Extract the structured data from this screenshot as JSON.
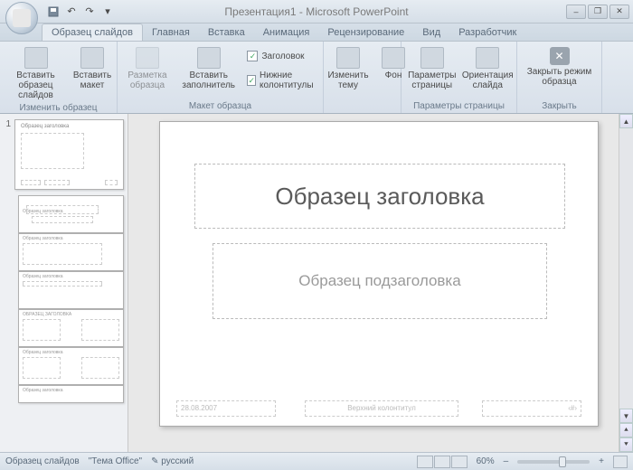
{
  "title": "Презентация1 - Microsoft PowerPoint",
  "qat": {
    "save": "💾",
    "undo": "↶",
    "redo": "↷"
  },
  "tabs": {
    "active": "Образец слайдов",
    "items": [
      "Образец слайдов",
      "Главная",
      "Вставка",
      "Анимация",
      "Рецензирование",
      "Вид",
      "Разработчик"
    ]
  },
  "ribbon": {
    "group1": {
      "label": "Изменить образец",
      "btn1": "Вставить образец слайдов",
      "btn2": "Вставить макет"
    },
    "group2": {
      "label": "Макет образца",
      "btn1": "Разметка образца",
      "btn2": "Вставить заполнитель",
      "chk1": "Заголовок",
      "chk2": "Нижние колонтитулы"
    },
    "group3": {
      "btn1": "Изменить тему",
      "btn2": "Фон"
    },
    "group4": {
      "label": "Параметры страницы",
      "btn1": "Параметры страницы",
      "btn2": "Ориентация слайда"
    },
    "group5": {
      "label": "Закрыть",
      "btn1": "Закрыть режим образца"
    }
  },
  "slide": {
    "title_placeholder": "Образец заголовка",
    "subtitle_placeholder": "Образец подзаголовка",
    "date": "28.08.2007",
    "footer": "Верхний колонтитул",
    "num": "‹#›"
  },
  "thumbs": {
    "master_num": "1",
    "master_title": "Образец заголовка",
    "layout_titles": [
      "Образец заголовка",
      "Образец заголовка",
      "Образец заголовка",
      "ОБРАЗЕЦ ЗАГОЛОВКА",
      "Образец заголовка",
      "Образец заголовка"
    ]
  },
  "status": {
    "left1": "Образец слайдов",
    "left2": "\"Тема Office\"",
    "lang": "русский",
    "zoom": "60%"
  }
}
